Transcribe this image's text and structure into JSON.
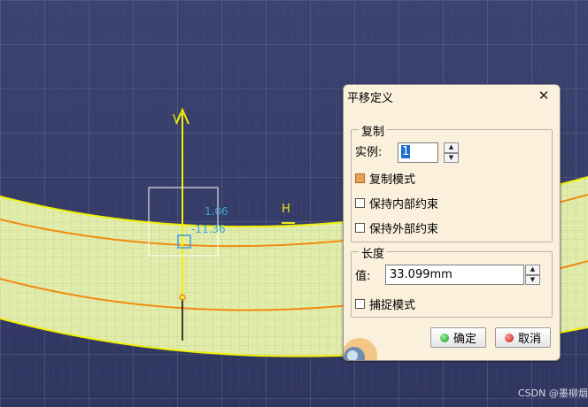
{
  "dialog": {
    "title": "平移定义",
    "close_glyph": "✕",
    "copy_group": {
      "title": "复制",
      "instance_label": "实例:",
      "instance_value": "1",
      "copy_mode_label": "复制模式",
      "copy_mode_checked": true,
      "keep_internal_label": "保持内部约束",
      "keep_internal_checked": false,
      "keep_external_label": "保持外部约束",
      "keep_external_checked": false
    },
    "length_group": {
      "title": "长度",
      "value_label": "值:",
      "value": "33.099mm",
      "snap_mode_label": "捕捉模式",
      "snap_mode_checked": false
    },
    "ok_label": "确定",
    "cancel_label": "取消"
  },
  "canvas": {
    "background_color": "#3d4470",
    "surface_color": "#e2ecaa",
    "v_axis_label": "V",
    "h_axis_label": "H",
    "dimension_1": "1.06",
    "dimension_2": "-11.36"
  },
  "watermark": "CSDN @墨柳烟",
  "icons": [
    "close-icon",
    "spin-up-icon",
    "spin-down-icon",
    "green-dot-icon",
    "red-dot-icon"
  ]
}
